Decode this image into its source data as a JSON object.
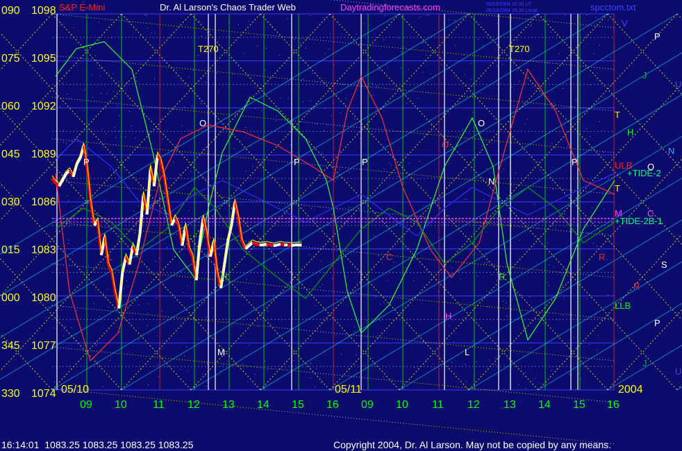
{
  "header": {
    "instrument": "S&P E-Mini",
    "title": "Dr. Al Larson's Chaos Trader Web",
    "site": "Daytradingforecasts.com",
    "stamp1": "05/10/2004 20:30 UT",
    "stamp2": "05/10/2004 15:30 Local",
    "file": "spcctom.txt"
  },
  "footer": {
    "quote": "16:14:01  1083.25 1083.25 1083.25 1083.25",
    "copyright": "Copyright 2004, Dr. Al Larson. May not be copied by any means."
  },
  "colors": {
    "background": "#0b0b6e",
    "grid": "#3a3aff",
    "axis_text": "#ffff00",
    "time_text": "#00ff00",
    "price_line_up": "#ffffff",
    "price_line_down": "#ff0000",
    "flux_line": "#ffff00",
    "tide_line": "#b040ff"
  },
  "chart_data": {
    "type": "line",
    "y_angle_labels": [
      "090",
      "075",
      "060",
      "045",
      "030",
      "015",
      "000",
      "345",
      "330"
    ],
    "y_price_labels": [
      "1098",
      "1095",
      "1092",
      "1089",
      "1086",
      "1083",
      "1080",
      "1077",
      "1074"
    ],
    "ylim": [
      1074,
      1098
    ],
    "x_tick_labels": [
      "09",
      "10",
      "11",
      "12",
      "13",
      "14",
      "15",
      "16",
      "09",
      "10",
      "11",
      "12",
      "13",
      "14",
      "15",
      "16"
    ],
    "date_labels": [
      "05/10",
      "05/11"
    ],
    "year_label": "2004",
    "annotations_top": [
      "T270",
      "T270"
    ],
    "right_labels": [
      {
        "text": "V",
        "color": "#4040ff"
      },
      {
        "text": "P",
        "color": "#ffffff"
      },
      {
        "text": "J",
        "color": "#00c000"
      },
      {
        "text": "U",
        "color": "#4040ff"
      },
      {
        "text": "T",
        "color": "#ffff00"
      },
      {
        "text": "H",
        "color": "#00ff00"
      },
      {
        "text": "O",
        "color": "#ffffff"
      },
      {
        "text": "N",
        "color": "#00c0ff"
      },
      {
        "text": "ULB",
        "color": "#ff2020"
      },
      {
        "text": "+TIDE-2",
        "color": "#00ff80"
      },
      {
        "text": "T",
        "color": "#ffff00"
      },
      {
        "text": "M",
        "color": "#ff40ff"
      },
      {
        "text": "C",
        "color": "#ff40ff"
      },
      {
        "text": "+TIDE-2B-1",
        "color": "#00ff80"
      },
      {
        "text": "S",
        "color": "#ffffff"
      },
      {
        "text": "R",
        "color": "#ff2020"
      },
      {
        "text": "LLB",
        "color": "#00ff00"
      },
      {
        "text": "P",
        "color": "#ffffff"
      },
      {
        "text": "J",
        "color": "#00c000"
      },
      {
        "text": "U",
        "color": "#4040ff"
      }
    ],
    "in_chart_labels": [
      "P",
      "O",
      "P",
      "P",
      "O",
      "P",
      "N",
      "O",
      "C",
      "R",
      "R",
      "H",
      "H",
      "M",
      "L",
      "L"
    ],
    "series": [
      {
        "name": "S&P E-Mini",
        "x": [
          0,
          0.1,
          0.2,
          0.3,
          0.4,
          0.5,
          0.6,
          0.7,
          0.8,
          0.9,
          1.0,
          1.1,
          1.2,
          1.3,
          1.4,
          1.5,
          1.6,
          1.7,
          1.8,
          1.9,
          2.0,
          2.1,
          2.2,
          2.3,
          2.4,
          2.5,
          2.6,
          2.7,
          2.8,
          2.9,
          3.0,
          3.1,
          3.2,
          3.3,
          3.4,
          3.5,
          3.6,
          3.7,
          3.8,
          3.9,
          4.0,
          4.1,
          4.2,
          4.3,
          4.4,
          4.5,
          4.6,
          4.7,
          4.8,
          4.9,
          5.0,
          5.1,
          5.2,
          5.3,
          5.4,
          5.5,
          5.6,
          5.7,
          5.8,
          5.9,
          6.0,
          6.1,
          6.2,
          6.3,
          6.4,
          6.5,
          6.6,
          6.7,
          6.8,
          6.9,
          7.0,
          7.1
        ],
        "values": [
          1087.5,
          1087.2,
          1087.0,
          1087.4,
          1087.8,
          1088.0,
          1087.6,
          1088.4,
          1088.8,
          1089.6,
          1088.2,
          1086.0,
          1084.5,
          1084.8,
          1082.6,
          1083.8,
          1082.0,
          1081.5,
          1080.2,
          1079.2,
          1081.5,
          1082.5,
          1082.0,
          1083.2,
          1082.6,
          1084.0,
          1086.5,
          1085.2,
          1088.2,
          1087.0,
          1089.0,
          1088.6,
          1087.5,
          1086.0,
          1084.5,
          1085.0,
          1084.5,
          1083.2,
          1084.5,
          1083.0,
          1082.5,
          1081.0,
          1083.4,
          1085.0,
          1084.0,
          1082.5,
          1083.5,
          1081.5,
          1080.5,
          1082.0,
          1083.5,
          1084.5,
          1086.0,
          1085.0,
          1083.5,
          1083.0,
          1083.2,
          1083.4,
          1083.3,
          1083.25,
          1083.25,
          1083.3,
          1083.25,
          1083.2,
          1083.25,
          1083.3,
          1083.25,
          1083.25,
          1083.2,
          1083.25,
          1083.25,
          1083.25
        ]
      }
    ]
  }
}
